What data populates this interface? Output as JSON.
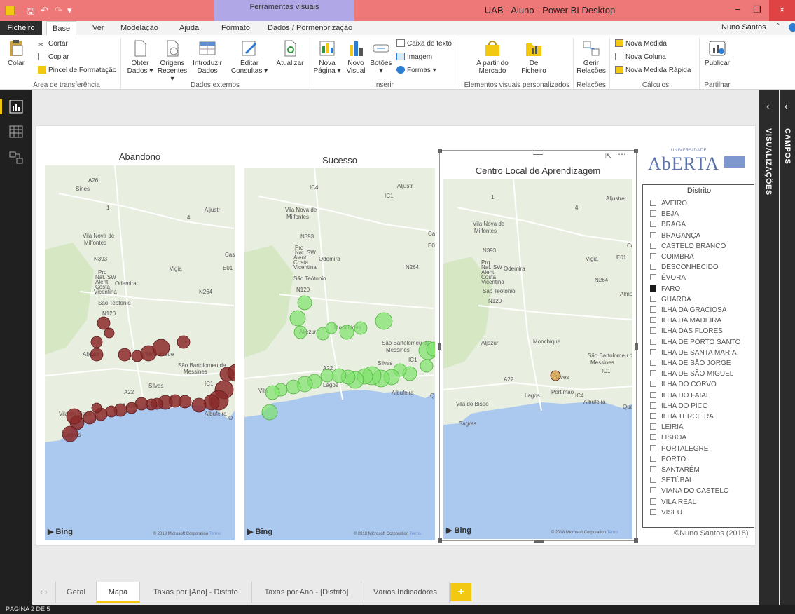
{
  "titlebar": {
    "context_tab": "Ferramentas visuais",
    "window_title": "UAB - Aluno - Power BI Desktop",
    "minimize": "−",
    "restore": "❐",
    "close": "×"
  },
  "ribbon_tabs": [
    {
      "label": "Ficheiro"
    },
    {
      "label": "Base"
    },
    {
      "label": "Ver"
    },
    {
      "label": "Modelação"
    },
    {
      "label": "Ajuda"
    },
    {
      "label": "Formato"
    },
    {
      "label": "Dados / Pormenorização"
    }
  ],
  "user": {
    "name": "Nuno Santos"
  },
  "ribbon": {
    "clipboard": {
      "paste": "Colar",
      "cut": "Cortar",
      "copy": "Copiar",
      "format_painter": "Pincel de Formatação",
      "group": "Área de transferência"
    },
    "external": {
      "get_data_1": "Obter",
      "get_data_2": "Dados ▾",
      "recent_1": "Origens",
      "recent_2": "Recentes ▾",
      "enter_1": "Introduzir",
      "enter_2": "Dados",
      "edit_1": "Editar",
      "edit_2": "Consultas ▾",
      "refresh": "Atualizar",
      "group": "Dados externos"
    },
    "insert": {
      "new_page_1": "Nova",
      "new_page_2": "Página ▾",
      "new_visual_1": "Novo",
      "new_visual_2": "Visual",
      "buttons_1": "Botões",
      "buttons_2": "▾",
      "textbox": "Caixa de texto",
      "image": "Imagem",
      "shapes": "Formas ▾",
      "group": "Inserir"
    },
    "custom": {
      "market_1": "A partir do",
      "market_2": "Mercado",
      "file_1": "De",
      "file_2": "Ficheiro",
      "group": "Elementos visuais personalizados"
    },
    "relations": {
      "manage_1": "Gerir",
      "manage_2": "Relações",
      "group": "Relações"
    },
    "calc": {
      "new_measure": "Nova Medida",
      "new_column": "Nova Coluna",
      "quick_measure": "Nova Medida Rápida",
      "group": "Cálculos"
    },
    "share": {
      "publish": "Publicar",
      "group": "Partilhar"
    }
  },
  "panes": {
    "visualizations": "VISUALIZAÇÕES",
    "fields": "CAMPOS"
  },
  "maps": [
    {
      "title": "Abandono",
      "color": "#8b2a2a",
      "labels": [
        "A26",
        "Sines",
        "1",
        "Aljustr",
        "4",
        "Vila Nova de",
        "Milfontes",
        "Cast",
        "N393",
        "E01",
        "Prq",
        "Nat. SW",
        "Alent",
        "Costa",
        "Vicentina",
        "Odemira",
        "Vigia",
        "N264",
        "São Teótonio",
        "N120",
        "Aljezur",
        "Monchique",
        "São Bartolomeu de",
        "Messines",
        "IC1",
        "A22",
        "Silves",
        "Lagos",
        "Vila do Bispo",
        "Albufeira",
        "O",
        "Sagres"
      ],
      "bing": "Bing",
      "copyright": "© 2018 Microsoft Corporation",
      "terms": "Terms"
    },
    {
      "title": "Sucesso",
      "color": "#7ee36b",
      "labels": [
        "IC4",
        "Aljustr",
        "IC1",
        "Vila Nova de",
        "Milfontes",
        "Cas",
        "N393",
        "E01",
        "Prq",
        "Nat. SW",
        "Alent",
        "Costa",
        "Vicentina",
        "Odemira",
        "N264",
        "São Teótonio",
        "N120",
        "Aljezur",
        "Monchique",
        "São Bartolomeu de",
        "Messines",
        "IC1",
        "A22",
        "Silves",
        "Lagos",
        "Vila",
        "Albufeira",
        "Q"
      ],
      "bing": "Bing",
      "copyright": "© 2018 Microsoft Corporation",
      "terms": "Terms"
    },
    {
      "title": "Centro Local de Aprendizagem",
      "color": "#d2a24c",
      "labels": [
        "1",
        "4",
        "Aljustrel",
        "Vila Nova de",
        "Milfontes",
        "Castro V",
        "N393",
        "E01",
        "Prq",
        "Nat. SW",
        "Alent",
        "Costa",
        "Vicentina",
        "Odemira",
        "Vigia",
        "N264",
        "São Teótonio",
        "N120",
        "Almo",
        "Aljezur",
        "Monchique",
        "São Bartolomeu de",
        "Messines",
        "IC1",
        "A22",
        "Silves",
        "Portimão",
        "IC4",
        "Lagos",
        "Vila do Bispo",
        "Albufeira",
        "Quarte",
        "Sagres"
      ],
      "bing": "Bing",
      "copyright": "© 2018 Microsoft Corporation",
      "terms": "Terms"
    }
  ],
  "logo": {
    "small": "UNIVERSIDADE",
    "main": "AbERTA"
  },
  "slicer": {
    "title": "Distrito",
    "items": [
      {
        "label": "AVEIRO",
        "checked": false
      },
      {
        "label": "BEJA",
        "checked": false
      },
      {
        "label": "BRAGA",
        "checked": false
      },
      {
        "label": "BRAGANÇA",
        "checked": false
      },
      {
        "label": "CASTELO BRANCO",
        "checked": false
      },
      {
        "label": "COIMBRA",
        "checked": false
      },
      {
        "label": "DESCONHECIDO",
        "checked": false
      },
      {
        "label": "ÉVORA",
        "checked": false
      },
      {
        "label": "FARO",
        "checked": true
      },
      {
        "label": "GUARDA",
        "checked": false
      },
      {
        "label": "ILHA DA GRACIOSA",
        "checked": false
      },
      {
        "label": "ILHA DA MADEIRA",
        "checked": false
      },
      {
        "label": "ILHA DAS FLORES",
        "checked": false
      },
      {
        "label": "ILHA DE PORTO SANTO",
        "checked": false
      },
      {
        "label": "ILHA DE SANTA MARIA",
        "checked": false
      },
      {
        "label": "ILHA DE SÃO JORGE",
        "checked": false
      },
      {
        "label": "ILHA DE SÃO MIGUEL",
        "checked": false
      },
      {
        "label": "ILHA DO CORVO",
        "checked": false
      },
      {
        "label": "ILHA DO FAIAL",
        "checked": false
      },
      {
        "label": "ILHA DO PICO",
        "checked": false
      },
      {
        "label": "ILHA TERCEIRA",
        "checked": false
      },
      {
        "label": "LEIRIA",
        "checked": false
      },
      {
        "label": "LISBOA",
        "checked": false
      },
      {
        "label": "PORTALEGRE",
        "checked": false
      },
      {
        "label": "PORTO",
        "checked": false
      },
      {
        "label": "SANTARÉM",
        "checked": false
      },
      {
        "label": "SETÚBAL",
        "checked": false
      },
      {
        "label": "VIANA DO CASTELO",
        "checked": false
      },
      {
        "label": "VILA REAL",
        "checked": false
      },
      {
        "label": "VISEU",
        "checked": false
      }
    ]
  },
  "credit": "©Nuno Santos (2018)",
  "page_tabs": [
    {
      "label": "Geral",
      "active": false
    },
    {
      "label": "Mapa",
      "active": true
    },
    {
      "label": "Taxas por [Ano] - Distrito",
      "active": false
    },
    {
      "label": "Taxas por Ano - [Distrito]",
      "active": false
    },
    {
      "label": "Vários Indicadores",
      "active": false
    }
  ],
  "add_page": "+",
  "status": "PÁGINA 2 DE 5",
  "colors": {
    "accent": "#f2c811",
    "titlebar": "#ee7777",
    "abandono": "#8b2a2a",
    "sucesso": "#7ee36b",
    "clap": "#d2a24c"
  }
}
